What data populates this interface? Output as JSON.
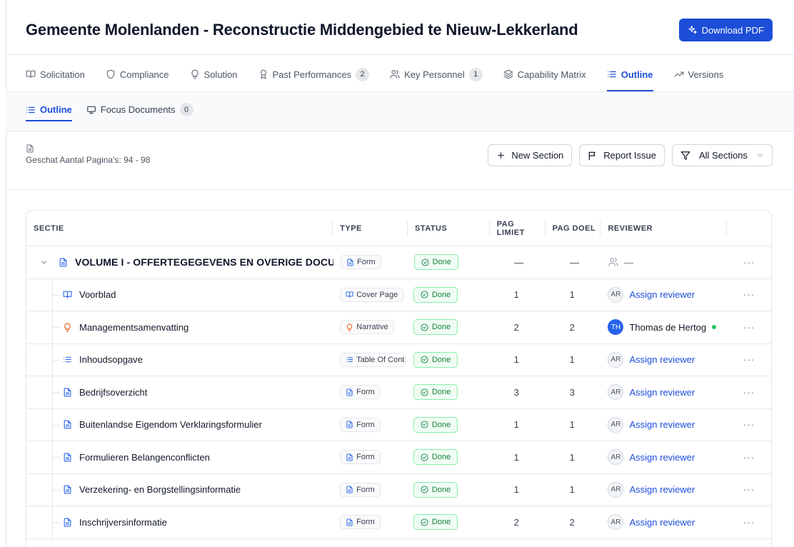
{
  "header": {
    "title": "Gemeente Molenlanden - Reconstructie Middengebied te Nieuw-Lekkerland",
    "download_label": "Download PDF"
  },
  "tabs": [
    {
      "label": "Solicitation",
      "icon": "book-open-icon"
    },
    {
      "label": "Compliance",
      "icon": "shield-icon"
    },
    {
      "label": "Solution",
      "icon": "lightbulb-icon"
    },
    {
      "label": "Past Performances",
      "icon": "award-icon",
      "count": "2"
    },
    {
      "label": "Key Personnel",
      "icon": "users-icon",
      "count": "1"
    },
    {
      "label": "Capability Matrix",
      "icon": "layers-icon"
    },
    {
      "label": "Outline",
      "icon": "list-icon",
      "active": true
    },
    {
      "label": "Versions",
      "icon": "trend-icon"
    }
  ],
  "subtabs": [
    {
      "label": "Outline",
      "icon": "list-icon",
      "active": true
    },
    {
      "label": "Focus Documents",
      "icon": "monitor-icon",
      "count": "0"
    }
  ],
  "toolbar": {
    "pages_estimate": "Geschat Aantal Pagina's: 94 - 98",
    "new_section": "New Section",
    "report_issue": "Report Issue",
    "filter_value": "All Sections"
  },
  "table": {
    "columns": {
      "section": "SECTIE",
      "type": "TYPE",
      "status": "STATUS",
      "page_limit": "PAG LIMIET",
      "page_goal": "PAG DOEL",
      "reviewer": "REVIEWER"
    },
    "volume": {
      "title": "VOLUME I - OFFERTEGEGEVENS EN OVERIGE DOCUMENTEN",
      "type": "Form",
      "status": "Done",
      "page_limit": "—",
      "page_goal": "—",
      "reviewer": "—",
      "actions": "···"
    },
    "rows": [
      {
        "title": "Voorblad",
        "icon": "book-open-icon",
        "type": "Cover Page",
        "type_icon": "book-open-icon",
        "status": "Done",
        "page_limit": "1",
        "page_goal": "1",
        "avatar": "AR",
        "reviewer": "Assign reviewer",
        "assigned": false,
        "actions": "···"
      },
      {
        "title": "Managementsamenvatting",
        "icon": "lightbulb-icon",
        "type": "Narrative",
        "type_icon": "lightbulb-icon",
        "status": "Done",
        "page_limit": "2",
        "page_goal": "2",
        "avatar": "TH",
        "reviewer": "Thomas de Hertog",
        "assigned": true,
        "actions": "···"
      },
      {
        "title": "Inhoudsopgave",
        "icon": "list-icon",
        "type": "Table Of Cont",
        "type_icon": "list-icon",
        "status": "Done",
        "page_limit": "1",
        "page_goal": "1",
        "avatar": "AR",
        "reviewer": "Assign reviewer",
        "assigned": false,
        "actions": "···"
      },
      {
        "title": "Bedrijfsoverzicht",
        "icon": "file-text-icon",
        "type": "Form",
        "type_icon": "file-text-icon",
        "status": "Done",
        "page_limit": "3",
        "page_goal": "3",
        "avatar": "AR",
        "reviewer": "Assign reviewer",
        "assigned": false,
        "actions": "···"
      },
      {
        "title": "Buitenlandse Eigendom Verklaringsformulier",
        "icon": "file-text-icon",
        "type": "Form",
        "type_icon": "file-text-icon",
        "status": "Done",
        "page_limit": "1",
        "page_goal": "1",
        "avatar": "AR",
        "reviewer": "Assign reviewer",
        "assigned": false,
        "actions": "···"
      },
      {
        "title": "Formulieren Belangenconflicten",
        "icon": "file-text-icon",
        "type": "Form",
        "type_icon": "file-text-icon",
        "status": "Done",
        "page_limit": "1",
        "page_goal": "1",
        "avatar": "AR",
        "reviewer": "Assign reviewer",
        "assigned": false,
        "actions": "···"
      },
      {
        "title": "Verzekering- en Borgstellingsinformatie",
        "icon": "file-text-icon",
        "type": "Form",
        "type_icon": "file-text-icon",
        "status": "Done",
        "page_limit": "1",
        "page_goal": "1",
        "avatar": "AR",
        "reviewer": "Assign reviewer",
        "assigned": false,
        "actions": "···"
      },
      {
        "title": "Inschrijversinformatie",
        "icon": "file-text-icon",
        "type": "Form",
        "type_icon": "file-text-icon",
        "status": "Done",
        "page_limit": "2",
        "page_goal": "2",
        "avatar": "AR",
        "reviewer": "Assign reviewer",
        "assigned": false,
        "actions": "···"
      }
    ]
  },
  "colors": {
    "accent": "#1d4ed8",
    "done_green": "#15803d",
    "online": "#22c55e",
    "narrative_orange": "#ea580c"
  }
}
